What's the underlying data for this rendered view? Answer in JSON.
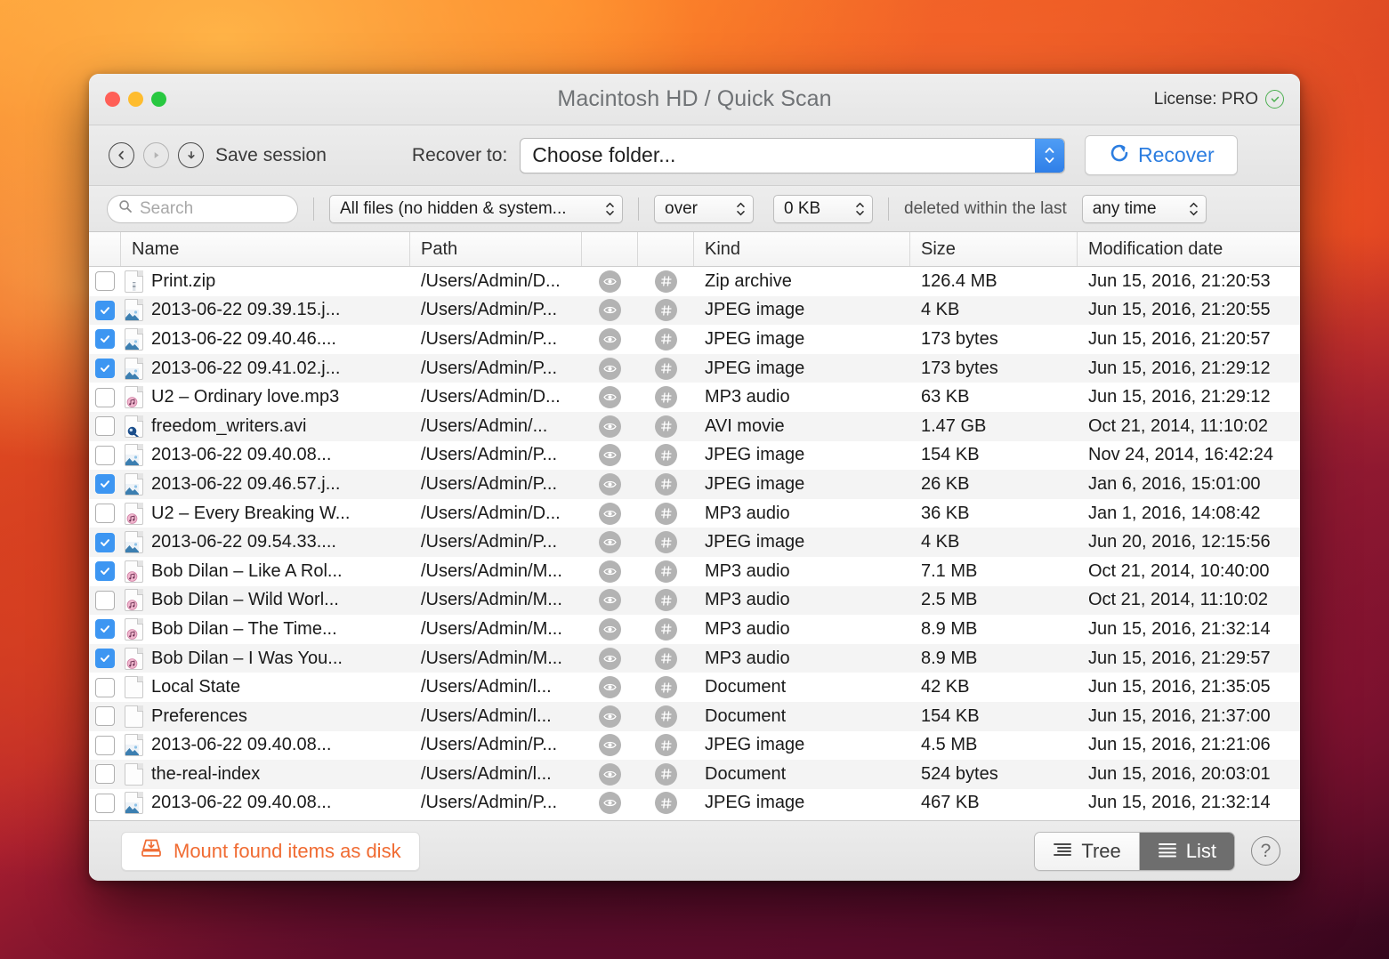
{
  "window": {
    "title": "Macintosh HD / Quick Scan",
    "license_label": "License: PRO"
  },
  "toolbar": {
    "save_session_label": "Save session",
    "recover_to_label": "Recover to:",
    "folder_value": "Choose folder...",
    "recover_button_label": "Recover"
  },
  "filters": {
    "search_placeholder": "Search",
    "file_type": "All files (no hidden & system...",
    "compare": "over",
    "size": "0 KB",
    "deleted_label": "deleted within the last",
    "time": "any time"
  },
  "table": {
    "columns": {
      "name": "Name",
      "path": "Path",
      "preview": "",
      "hex": "",
      "kind": "Kind",
      "size": "Size",
      "date": "Modification date"
    },
    "rows": [
      {
        "checked": false,
        "icon": "zip-file-icon",
        "name": "Print.zip",
        "path": "/Users/Admin/D...",
        "kind": "Zip archive",
        "size": "126.4 MB",
        "date": "Jun 15, 2016, 21:20:53"
      },
      {
        "checked": true,
        "icon": "jpeg-file-icon",
        "name": "2013-06-22 09.39.15.j...",
        "path": "/Users/Admin/P...",
        "kind": "JPEG image",
        "size": "4 KB",
        "date": "Jun 15, 2016, 21:20:55"
      },
      {
        "checked": true,
        "icon": "jpeg-file-icon",
        "name": "2013-06-22 09.40.46....",
        "path": "/Users/Admin/P...",
        "kind": "JPEG image",
        "size": "173 bytes",
        "date": "Jun 15, 2016, 21:20:57"
      },
      {
        "checked": true,
        "icon": "jpeg-file-icon",
        "name": "2013-06-22 09.41.02.j...",
        "path": "/Users/Admin/P...",
        "kind": "JPEG image",
        "size": "173 bytes",
        "date": "Jun 15, 2016, 21:29:12"
      },
      {
        "checked": false,
        "icon": "mp3-file-icon",
        "name": "U2 – Ordinary love.mp3",
        "path": "/Users/Admin/D...",
        "kind": "MP3 audio",
        "size": "63 KB",
        "date": "Jun 15, 2016, 21:29:12"
      },
      {
        "checked": false,
        "icon": "avi-movie-file-icon",
        "name": "freedom_writers.avi",
        "path": "/Users/Admin/...",
        "kind": " AVI movie",
        "size": "1.47 GB",
        "date": "Oct 21, 2014, 11:10:02"
      },
      {
        "checked": false,
        "icon": "jpeg-file-icon",
        "name": " 2013-06-22 09.40.08...",
        "path": "/Users/Admin/P...",
        "kind": "JPEG image",
        "size": "154 KB",
        "date": "Nov 24, 2014, 16:42:24"
      },
      {
        "checked": true,
        "icon": "jpeg-file-icon",
        "name": "2013-06-22 09.46.57.j...",
        "path": "/Users/Admin/P...",
        "kind": "JPEG image",
        "size": "26 KB",
        "date": "Jan 6, 2016, 15:01:00"
      },
      {
        "checked": false,
        "icon": "mp3-file-icon",
        "name": "U2 – Every Breaking W...",
        "path": "/Users/Admin/D...",
        "kind": "MP3 audio",
        "size": "36 KB",
        "date": "Jan 1, 2016, 14:08:42"
      },
      {
        "checked": true,
        "icon": "jpeg-file-icon",
        "name": "2013-06-22 09.54.33....",
        "path": "/Users/Admin/P...",
        "kind": "JPEG image",
        "size": "4 KB",
        "date": "Jun 20, 2016, 12:15:56"
      },
      {
        "checked": true,
        "icon": "mp3-file-icon",
        "name": "Bob Dilan – Like A Rol...",
        "path": "/Users/Admin/M...",
        "kind": "MP3 audio",
        "size": "7.1 MB",
        "date": "Oct 21, 2014, 10:40:00"
      },
      {
        "checked": false,
        "icon": "mp3-file-icon",
        "name": "Bob Dilan – Wild Worl...",
        "path": "/Users/Admin/M...",
        "kind": "MP3 audio",
        "size": "2.5 MB",
        "date": "Oct 21, 2014, 11:10:02"
      },
      {
        "checked": true,
        "icon": "mp3-file-icon",
        "name": "Bob Dilan – The Time...",
        "path": "/Users/Admin/M...",
        "kind": "MP3 audio",
        "size": "8.9 MB",
        "date": "Jun 15, 2016, 21:32:14"
      },
      {
        "checked": true,
        "icon": "mp3-file-icon",
        "name": "Bob Dilan – I Was You...",
        "path": "/Users/Admin/M...",
        "kind": "MP3 audio",
        "size": "8.9 MB",
        "date": "Jun 15, 2016, 21:29:57"
      },
      {
        "checked": false,
        "icon": "document-file-icon",
        "name": "Local State",
        "path": "/Users/Admin/l...",
        "kind": "Document",
        "size": "42 KB",
        "date": "Jun 15, 2016, 21:35:05"
      },
      {
        "checked": false,
        "icon": "document-file-icon",
        "name": "Preferences",
        "path": "/Users/Admin/l...",
        "kind": "Document",
        "size": "154 KB",
        "date": "Jun 15, 2016, 21:37:00"
      },
      {
        "checked": false,
        "icon": "jpeg-file-icon",
        "name": "2013-06-22 09.40.08...",
        "path": "/Users/Admin/P...",
        "kind": "JPEG image",
        "size": "4.5 MB",
        "date": "Jun 15, 2016, 21:21:06"
      },
      {
        "checked": false,
        "icon": "document-file-icon",
        "name": "the-real-index",
        "path": "/Users/Admin/l...",
        "kind": "Document",
        "size": "524 bytes",
        "date": "Jun 15, 2016, 20:03:01"
      },
      {
        "checked": false,
        "icon": "jpeg-file-icon",
        "name": "2013-06-22 09.40.08...",
        "path": "/Users/Admin/P...",
        "kind": "JPEG image",
        "size": "467 KB",
        "date": "Jun 15, 2016, 21:32:14"
      }
    ]
  },
  "footer": {
    "mount_label": "Mount found items as disk",
    "tree_label": "Tree",
    "list_label": "List",
    "help_label": "?"
  },
  "colors": {
    "accent_blue": "#3d96f2",
    "recover_blue": "#2b7de0",
    "mount_orange": "#f06b32",
    "license_green": "#4caf50",
    "active_segment": "#6e6e6e"
  }
}
